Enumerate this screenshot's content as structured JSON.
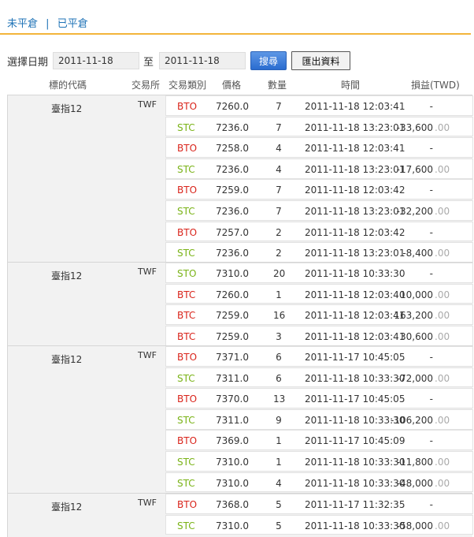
{
  "tabs": [
    {
      "label": "未平倉"
    },
    {
      "label": "已平倉"
    }
  ],
  "tab_separator": "|",
  "filter": {
    "date_label": "選擇日期",
    "from": "2011-11-18",
    "to_label": "至",
    "to": "2011-11-18",
    "search_label": "搜尋",
    "export_label": "匯出資料"
  },
  "columns": {
    "symbol": "標的代碼",
    "exchange": "交易所",
    "type": "交易類別",
    "price": "價格",
    "qty": "數量",
    "time": "時間",
    "pnl": "損益(TWD)"
  },
  "colors": {
    "link": "#1f73b7",
    "rule": "#f3b53a",
    "buy": "#d9241b",
    "sell": "#7ab317",
    "search_button": "#2a6cd0"
  },
  "groups": [
    {
      "symbol": "臺指12",
      "exchange": "TWF",
      "rows": [
        {
          "type": "BTO",
          "price": "7260.0",
          "qty": "7",
          "time": "2011-11-18 12:03:41",
          "pnl": "-",
          "dec": ""
        },
        {
          "type": "STC",
          "price": "7236.0",
          "qty": "7",
          "time": "2011-11-18 13:23:01",
          "pnl": "-33,600",
          "dec": ".00"
        },
        {
          "type": "BTO",
          "price": "7258.0",
          "qty": "4",
          "time": "2011-11-18 12:03:41",
          "pnl": "-",
          "dec": ""
        },
        {
          "type": "STC",
          "price": "7236.0",
          "qty": "4",
          "time": "2011-11-18 13:23:01",
          "pnl": "-17,600",
          "dec": ".00"
        },
        {
          "type": "BTO",
          "price": "7259.0",
          "qty": "7",
          "time": "2011-11-18 12:03:42",
          "pnl": "-",
          "dec": ""
        },
        {
          "type": "STC",
          "price": "7236.0",
          "qty": "7",
          "time": "2011-11-18 13:23:01",
          "pnl": "-32,200",
          "dec": ".00"
        },
        {
          "type": "BTO",
          "price": "7257.0",
          "qty": "2",
          "time": "2011-11-18 12:03:42",
          "pnl": "-",
          "dec": ""
        },
        {
          "type": "STC",
          "price": "7236.0",
          "qty": "2",
          "time": "2011-11-18 13:23:01",
          "pnl": "-8,400",
          "dec": ".00"
        }
      ]
    },
    {
      "symbol": "臺指12",
      "exchange": "TWF",
      "rows": [
        {
          "type": "STO",
          "price": "7310.0",
          "qty": "20",
          "time": "2011-11-18 10:33:30",
          "pnl": "-",
          "dec": ""
        },
        {
          "type": "BTC",
          "price": "7260.0",
          "qty": "1",
          "time": "2011-11-18 12:03:40",
          "pnl": "10,000",
          "dec": ".00"
        },
        {
          "type": "BTC",
          "price": "7259.0",
          "qty": "16",
          "time": "2011-11-18 12:03:41",
          "pnl": "163,200",
          "dec": ".00"
        },
        {
          "type": "BTC",
          "price": "7259.0",
          "qty": "3",
          "time": "2011-11-18 12:03:41",
          "pnl": "30,600",
          "dec": ".00"
        }
      ]
    },
    {
      "symbol": "臺指12",
      "exchange": "TWF",
      "rows": [
        {
          "type": "BTO",
          "price": "7371.0",
          "qty": "6",
          "time": "2011-11-17 10:45:05",
          "pnl": "-",
          "dec": ""
        },
        {
          "type": "STC",
          "price": "7311.0",
          "qty": "6",
          "time": "2011-11-18 10:33:30",
          "pnl": "-72,000",
          "dec": ".00"
        },
        {
          "type": "BTO",
          "price": "7370.0",
          "qty": "13",
          "time": "2011-11-17 10:45:05",
          "pnl": "-",
          "dec": ""
        },
        {
          "type": "STC",
          "price": "7311.0",
          "qty": "9",
          "time": "2011-11-18 10:33:30",
          "pnl": "-106,200",
          "dec": ".00"
        },
        {
          "type": "BTO",
          "price": "7369.0",
          "qty": "1",
          "time": "2011-11-17 10:45:09",
          "pnl": "-",
          "dec": ""
        },
        {
          "type": "STC",
          "price": "7310.0",
          "qty": "1",
          "time": "2011-11-18 10:33:30",
          "pnl": "-11,800",
          "dec": ".00"
        },
        {
          "type": "STC",
          "price": "7310.0",
          "qty": "4",
          "time": "2011-11-18 10:33:30",
          "pnl": "-48,000",
          "dec": ".00"
        }
      ]
    },
    {
      "symbol": "臺指12",
      "exchange": "TWF",
      "rows": [
        {
          "type": "BTO",
          "price": "7368.0",
          "qty": "5",
          "time": "2011-11-17 11:32:35",
          "pnl": "-",
          "dec": ""
        },
        {
          "type": "STC",
          "price": "7310.0",
          "qty": "5",
          "time": "2011-11-18 10:33:30",
          "pnl": "-58,000",
          "dec": ".00"
        }
      ]
    }
  ]
}
